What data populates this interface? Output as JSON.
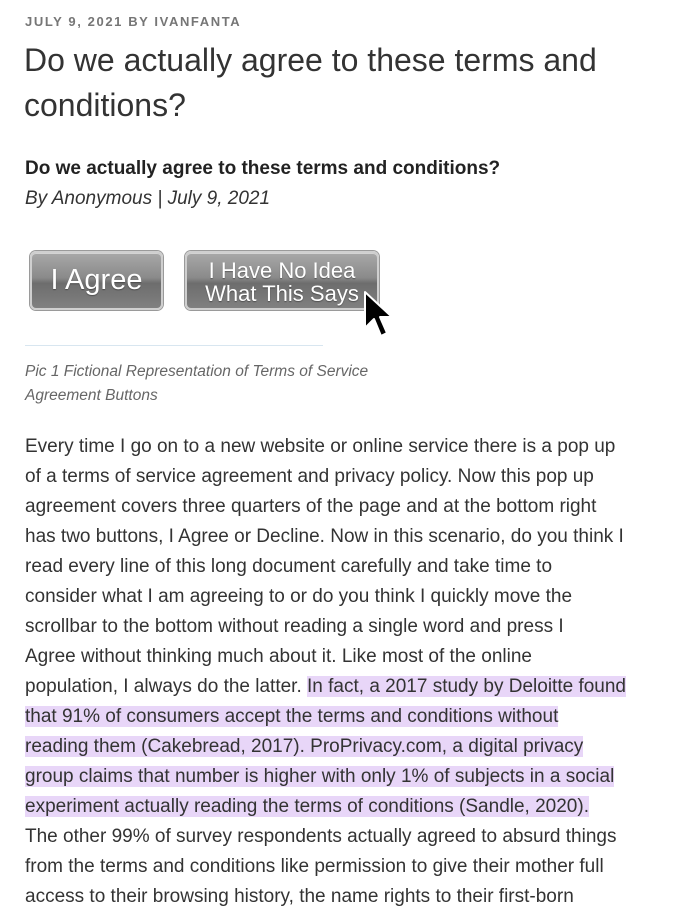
{
  "post": {
    "meta": "JULY 9, 2021 BY IVANFANTA",
    "title": "Do we actually agree to these terms and conditions?",
    "subheading": "Do we actually agree to these terms and conditions?",
    "byline": "By Anonymous | July 9, 2021"
  },
  "figure": {
    "button_agree": "I Agree",
    "button_noidea": "I Have No Idea\nWhat This Says",
    "cursor_icon": "arrow-cursor-icon",
    "caption": "Pic 1 Fictional Representation of Terms of Service Agreement Buttons"
  },
  "body": {
    "lines": [
      "Every time I go on to a new website or online service there is a pop up",
      "of a terms of service agreement and privacy policy. Now this pop up",
      "agreement covers three quarters of the page and at the bottom right",
      "has two buttons, I Agree or Decline. Now in this scenario, do you think I",
      "read every line of this long document carefully and take time to",
      "consider what I am agreeing to or do you think I quickly move the",
      "scrollbar to the bottom without reading a single word and press I",
      "Agree without thinking much about it. Like most of the online"
    ],
    "line9_plain": "population, I always do the latter. ",
    "line9_highlight": "In fact, a 2017 study by Deloitte found",
    "highlight_lines": [
      "that 91% of consumers accept the terms and conditions without",
      "reading them (Cakebread, 2017). ProPrivacy.com, a digital privacy",
      "group claims that number is higher with only 1% of subjects in a social",
      "experiment actually reading the terms of conditions (Sandle, 2020)."
    ],
    "after_lines": [
      "The other 99% of survey respondents actually agreed to absurd things",
      "from the terms and conditions like permission to give their mother full",
      "access to their browsing history, the name rights to their first-born"
    ]
  },
  "colors": {
    "highlight": "#e8d6f8",
    "meta_text": "#767676"
  }
}
